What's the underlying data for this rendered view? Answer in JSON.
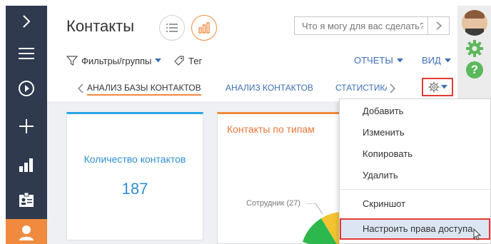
{
  "header": {
    "title": "Контакты",
    "search_placeholder": "Что я могу для вас сделать?"
  },
  "toolbar": {
    "filters_label": "Фильтры/группы",
    "tag_label": "Тег",
    "reports_label": "ОТЧЕТЫ",
    "view_label": "ВИД"
  },
  "tabs": [
    {
      "label": "АНАЛИЗ БАЗЫ КОНТАКТОВ",
      "active": true
    },
    {
      "label": "АНАЛИЗ КОНТАКТОВ",
      "active": false
    },
    {
      "label": "СТАТИСТИКА",
      "active": false
    }
  ],
  "widgets": {
    "count": {
      "title": "Количество контактов",
      "value": "187"
    },
    "types": {
      "title": "Контакты по типам",
      "pie_label": "Сотрудник (27)"
    }
  },
  "menu": {
    "items": [
      "Добавить",
      "Изменить",
      "Копировать",
      "Удалить",
      "Скриншот",
      "Настроить права доступа"
    ]
  },
  "colors": {
    "nav_bg": "#2f3a4f",
    "accent_orange": "#f08a3e",
    "link_blue": "#3d6fb6",
    "highlight_red": "#e53935",
    "widget_blue": "#2f8fd6",
    "gear_green": "#5cb85c"
  },
  "icons": [
    "chevron-right-icon",
    "hamburger-icon",
    "play-icon",
    "plus-icon",
    "bar-chart-icon",
    "id-card-icon",
    "user-icon",
    "list-view-icon",
    "chart-view-icon",
    "filter-icon",
    "tag-icon",
    "gear-icon",
    "help-icon",
    "cursor-icon"
  ]
}
